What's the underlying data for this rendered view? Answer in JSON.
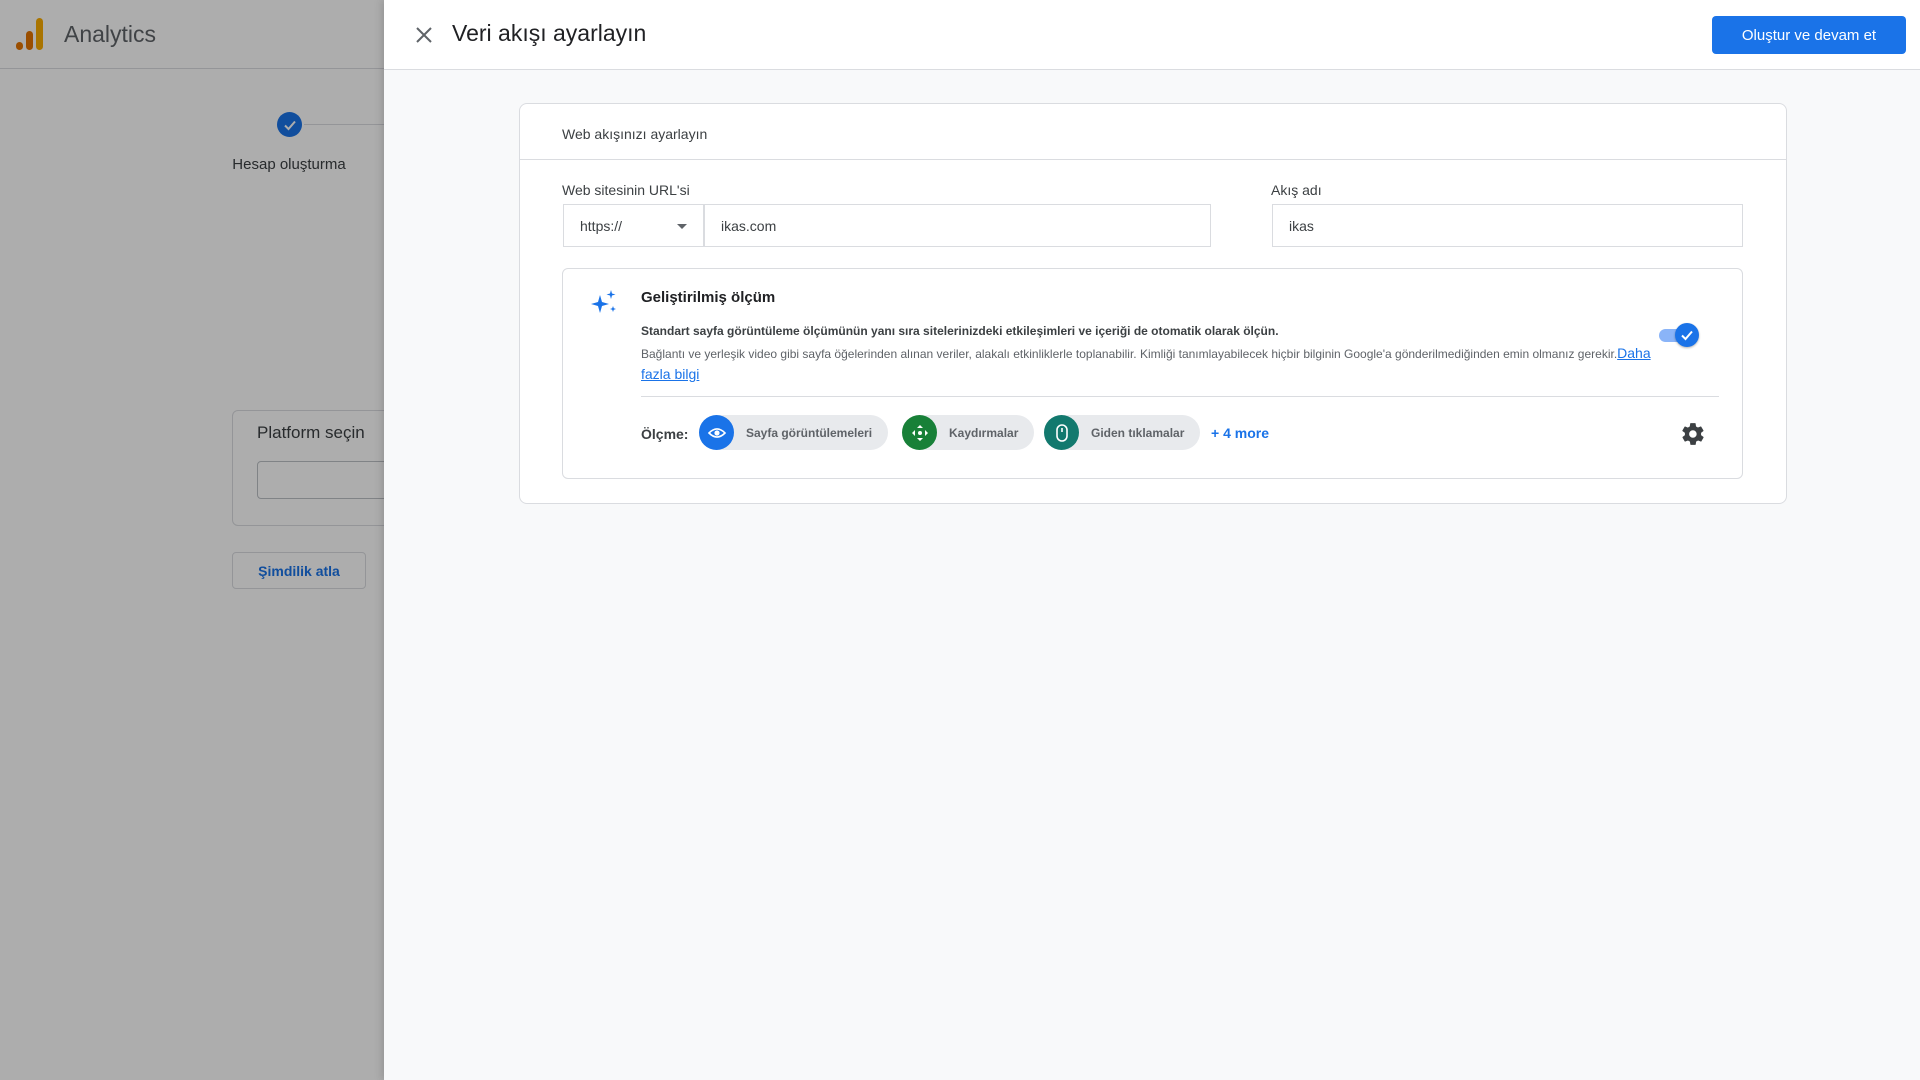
{
  "background": {
    "app_title": "Analytics",
    "step_label": "Hesap oluşturma",
    "platform_title": "Platform seçin",
    "skip_label": "Şimdilik atla"
  },
  "drawer": {
    "title": "Veri akışı ayarlayın",
    "primary_button": "Oluştur ve devam et"
  },
  "card": {
    "title": "Web akışınızı ayarlayın",
    "url_label": "Web sitesinin URL'si",
    "protocol_value": "https://",
    "url_value": "ikas.com",
    "stream_label": "Akış adı",
    "stream_value": "ikas"
  },
  "enhanced_measurement": {
    "title": "Geliştirilmiş ölçüm",
    "desc_bold": "Standart sayfa görüntüleme ölçümünün yanı sıra sitelerinizdeki etkileşimleri ve içeriği de otomatik olarak ölçün.",
    "desc": "Bağlantı ve yerleşik video gibi sayfa öğelerinden alınan veriler, alakalı etkinliklerle toplanabilir. Kimliği tanımlayabilecek hiçbir bilginin Google'a gönderilmediğinden emin olmanız gerekir.",
    "learn_more": "Daha fazla bilgi",
    "enabled": true,
    "measure_label": "Ölçme:",
    "chips": [
      {
        "label": "Sayfa görüntülemeleri",
        "icon": "eye-icon",
        "color": "#1a73e8"
      },
      {
        "label": "Kaydırmalar",
        "icon": "move-arrows-icon",
        "color": "#188038"
      },
      {
        "label": "Giden tıklamalar",
        "icon": "mouse-icon",
        "color": "#12796e"
      }
    ],
    "more_label": "+ 4 more"
  },
  "colors": {
    "primary": "#1a73e8",
    "logo_orange": "#f9ab00",
    "logo_dark_orange": "#e37400"
  }
}
